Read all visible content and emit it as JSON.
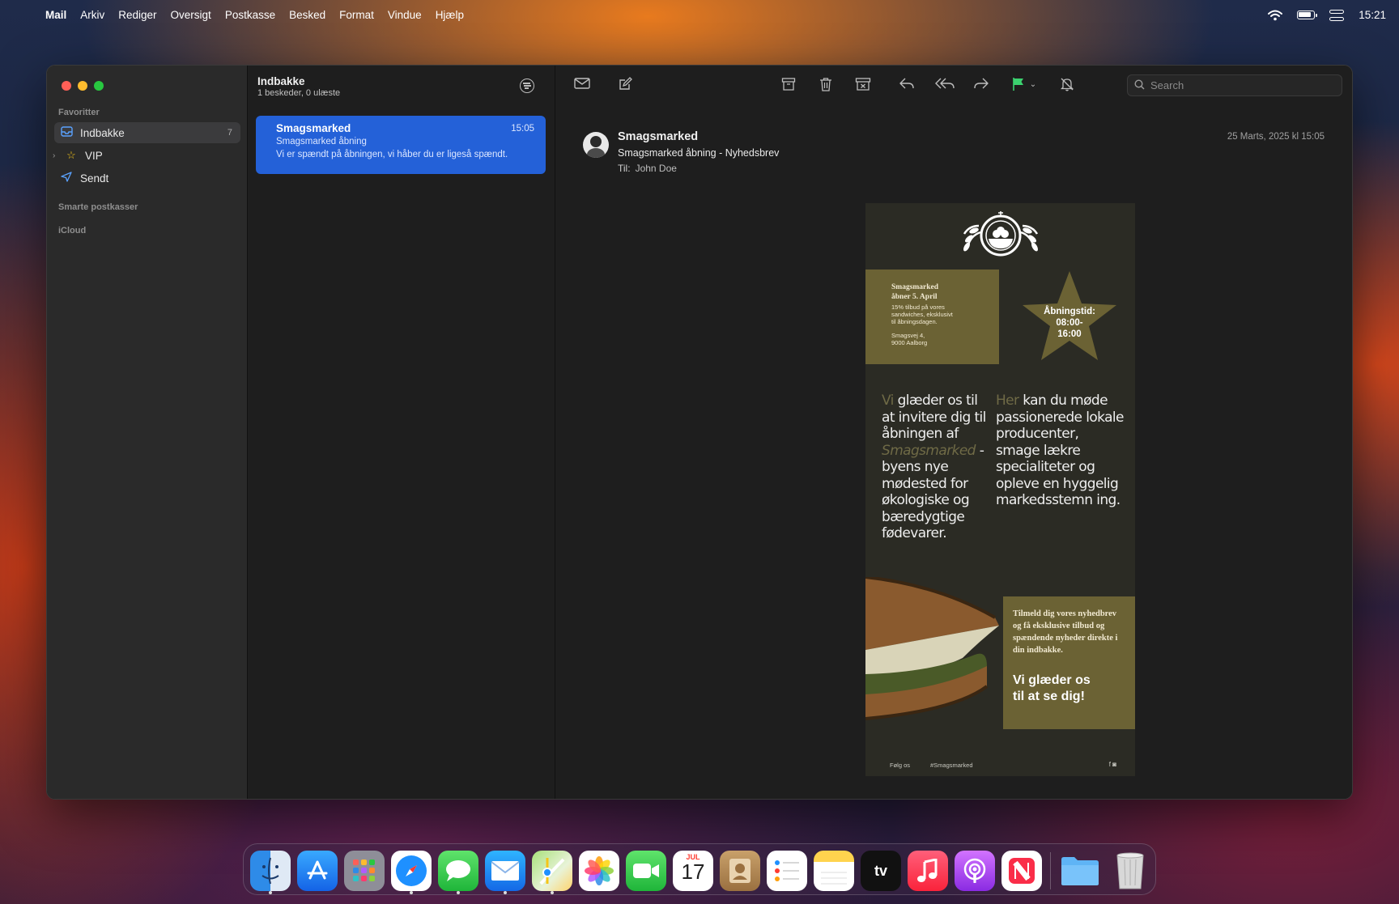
{
  "menubar": {
    "apple": "",
    "app_name": "Mail",
    "menus": [
      "Arkiv",
      "Rediger",
      "Oversigt",
      "Postkasse",
      "Besked",
      "Format",
      "Vindue",
      "Hjælp"
    ],
    "clock": "15:21"
  },
  "sidebar": {
    "favorites_label": "Favoritter",
    "items": [
      {
        "label": "Indbakke",
        "count": "7",
        "icon": "tray-icon"
      },
      {
        "label": "VIP",
        "icon": "star-icon"
      },
      {
        "label": "Sendt",
        "icon": "paperplane-icon"
      }
    ],
    "smart_label": "Smarte postkasser",
    "icloud_label": "iCloud"
  },
  "list": {
    "title": "Indbakke",
    "subtitle": "1 beskeder, 0 ulæste",
    "messages": [
      {
        "from": "Smagsmarked",
        "time": "15:05",
        "subject": "Smagsmarked åbning",
        "preview": "Vi er spændt på åbningen, vi håber du er ligeså spændt."
      }
    ]
  },
  "toolbar": {
    "search_placeholder": "Search"
  },
  "message": {
    "sender": "Smagsmarked",
    "subject": "Smagsmarked åbning - Nyhedsbrev",
    "to_label": "Til:",
    "to": "John Doe",
    "date": "25 Marts, 2025 kl 15:05"
  },
  "newsletter": {
    "box1_title_1": "Smagsmarked",
    "box1_title_2": "åbner 5. April",
    "box1_offer_1": "15% tilbud på vores",
    "box1_offer_2": "sandwiches, eksklusivt",
    "box1_offer_3": "til åbningsdagen.",
    "box1_addr_1": "Smagsvej 4,",
    "box1_addr_2": "9000 Aalborg",
    "hours_label": "Åbningstid:",
    "hours_1": "08:00-",
    "hours_2": "16:00",
    "col1_acc": "Vi",
    "col1_a": " glæder os til at invitere dig til åbningen af ",
    "col1_it": "Smagsmarked",
    "col1_b": " - byens nye mødested for økologiske og bæredygtige fødevarer.",
    "col2_acc": "Her",
    "col2_a": " kan du møde passionerede lokale producenter, smage lækre specialiteter og opleve en hyggelig markedsstemn ing.",
    "box2_text": "Tilmeld dig vores nyhedbrev og få eksklusive tilbud og spændende nyheder direkte i din indbakke.",
    "box2_bold_1": "Vi glæder os",
    "box2_bold_2": "til at se dig!",
    "follow": "Følg os",
    "hashtag": "#Smagsmarked",
    "social": "f  ◙"
  },
  "dock": {
    "calendar_month": "JUL",
    "calendar_day": "17",
    "tv_label": "tv"
  },
  "colors": {
    "accent": "#2461d8",
    "newsletter_bg": "#2b2b24",
    "newsletter_box": "#6b6234",
    "flag": "#3bd16f"
  }
}
